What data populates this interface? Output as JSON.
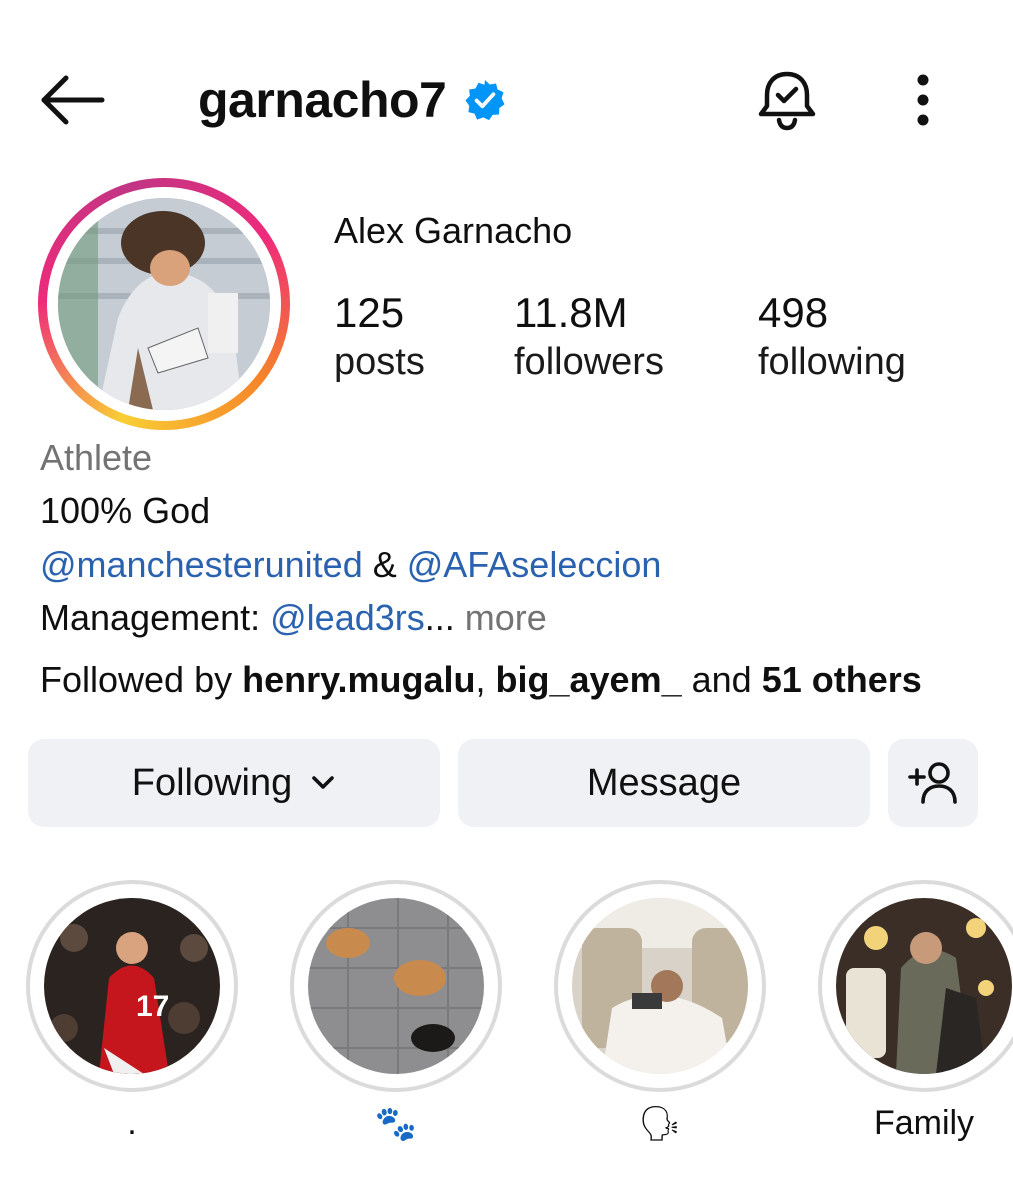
{
  "header": {
    "username": "garnacho7",
    "back_icon": "arrow-left-icon",
    "verified_icon": "verified-badge-icon",
    "bell_icon": "bell-check-icon",
    "more_icon": "more-vertical-icon"
  },
  "profile": {
    "display_name": "Alex Garnacho",
    "stats": {
      "posts_count": "125",
      "posts_label": "posts",
      "followers_count": "11.8M",
      "followers_label": "followers",
      "following_count": "498",
      "following_label": "following"
    }
  },
  "bio": {
    "category": "Athlete",
    "line1": "100% God",
    "mention1": "@manchesterunited",
    "amp": " & ",
    "mention2": "@AFAseleccion",
    "management_label": "Management: ",
    "management_mention": "@lead3rs",
    "ellipsis": "...",
    "more": " more",
    "followed_prefix": "Followed by ",
    "followed_user1": "henry.mugalu",
    "comma": ", ",
    "followed_user2": "big_ayem_",
    "followed_and": " and ",
    "followed_others": "51 others"
  },
  "actions": {
    "following_label": "Following",
    "message_label": "Message",
    "add_user_icon": "add-user-icon"
  },
  "highlights": [
    {
      "label": "."
    },
    {
      "label": "🐾"
    },
    {
      "label": "🗣"
    },
    {
      "label": "Family"
    }
  ],
  "colors": {
    "link": "#2b62b0",
    "verified": "#0095f6",
    "button_bg": "#eff1f4",
    "muted": "#737373"
  }
}
